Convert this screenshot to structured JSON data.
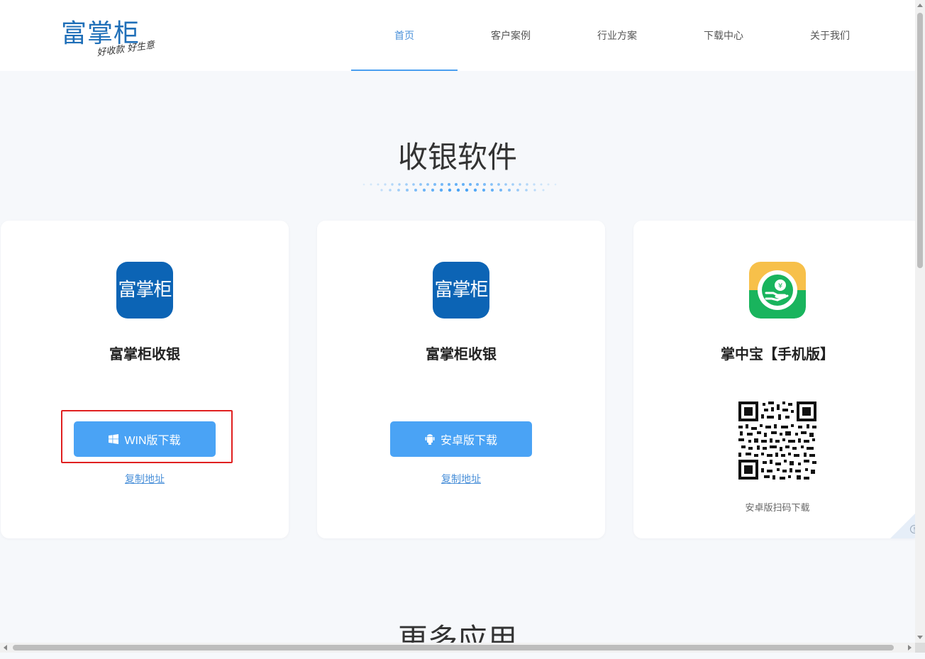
{
  "header": {
    "logo_main": "富掌柜",
    "logo_sub": "好收款 好生意",
    "nav": [
      {
        "label": "首页",
        "active": true
      },
      {
        "label": "客户案例",
        "active": false
      },
      {
        "label": "行业方案",
        "active": false
      },
      {
        "label": "下载中心",
        "active": false
      },
      {
        "label": "关于我们",
        "active": false
      }
    ]
  },
  "section1": {
    "title": "收银软件"
  },
  "section2": {
    "title": "更多应用"
  },
  "cards": [
    {
      "icon_text": "富掌柜",
      "title": "富掌柜收银",
      "button": "WIN版下载",
      "link": "复制地址",
      "icon": "windows-icon"
    },
    {
      "icon_text": "富掌柜",
      "title": "富掌柜收银",
      "button": "安卓版下载",
      "link": "复制地址",
      "icon": "android-icon"
    },
    {
      "title": "掌中宝【手机版】",
      "caption": "安卓版扫码下载",
      "icon": "money-hand-icon"
    }
  ],
  "colors": {
    "accent": "#4aa3f5",
    "brand": "#0c64b5",
    "highlight": "#e02020"
  }
}
